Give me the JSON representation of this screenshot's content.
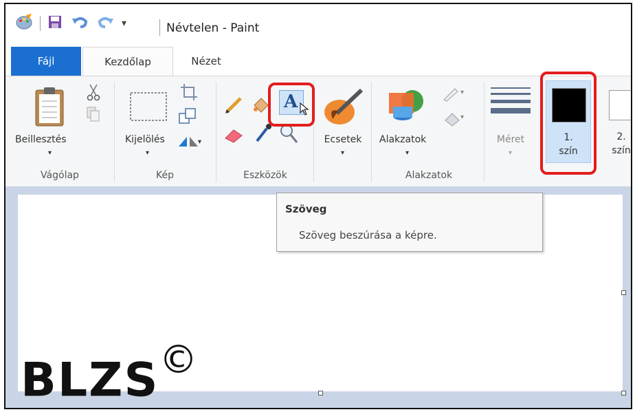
{
  "window": {
    "title": "Névtelen - Paint"
  },
  "tabs": [
    {
      "label": "Fájl"
    },
    {
      "label": "Kezdőlap"
    },
    {
      "label": "Nézet"
    }
  ],
  "ribbon": {
    "clipboard": {
      "paste_label": "Beillesztés",
      "group_label": "Vágólap"
    },
    "image": {
      "select_label": "Kijelölés",
      "group_label": "Kép"
    },
    "tools": {
      "group_label": "Eszközök"
    },
    "brushes": {
      "label": "Ecsetek"
    },
    "shapes": {
      "shapes_label": "Alakzatok",
      "group_label": "Alakzatok"
    },
    "size": {
      "label": "Méret"
    },
    "color1": {
      "line1": "1.",
      "line2": "szín",
      "color": "#000000"
    },
    "color2": {
      "line1": "2.",
      "line2": "szín",
      "color": "#ffffff"
    }
  },
  "tooltip": {
    "title": "Szöveg",
    "description": "Szöveg beszúrása a képre."
  },
  "watermark": {
    "text": "BLZS",
    "symbol": "©"
  },
  "colors": {
    "file_tab": "#1a6fd1",
    "highlight": "#e21d1d",
    "workarea": "#c9d4e6"
  }
}
